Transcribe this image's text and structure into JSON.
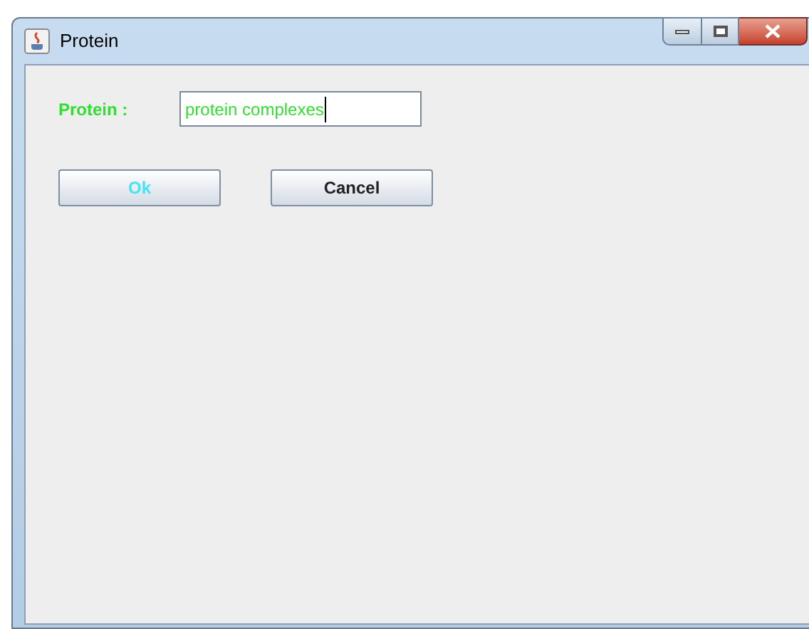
{
  "window": {
    "title": "Protein"
  },
  "field": {
    "label": "Protein :",
    "value": "protein complexes"
  },
  "buttons": [
    {
      "label": "Ok",
      "kind": "accent"
    },
    {
      "label": "Cancel",
      "kind": "plain"
    }
  ]
}
